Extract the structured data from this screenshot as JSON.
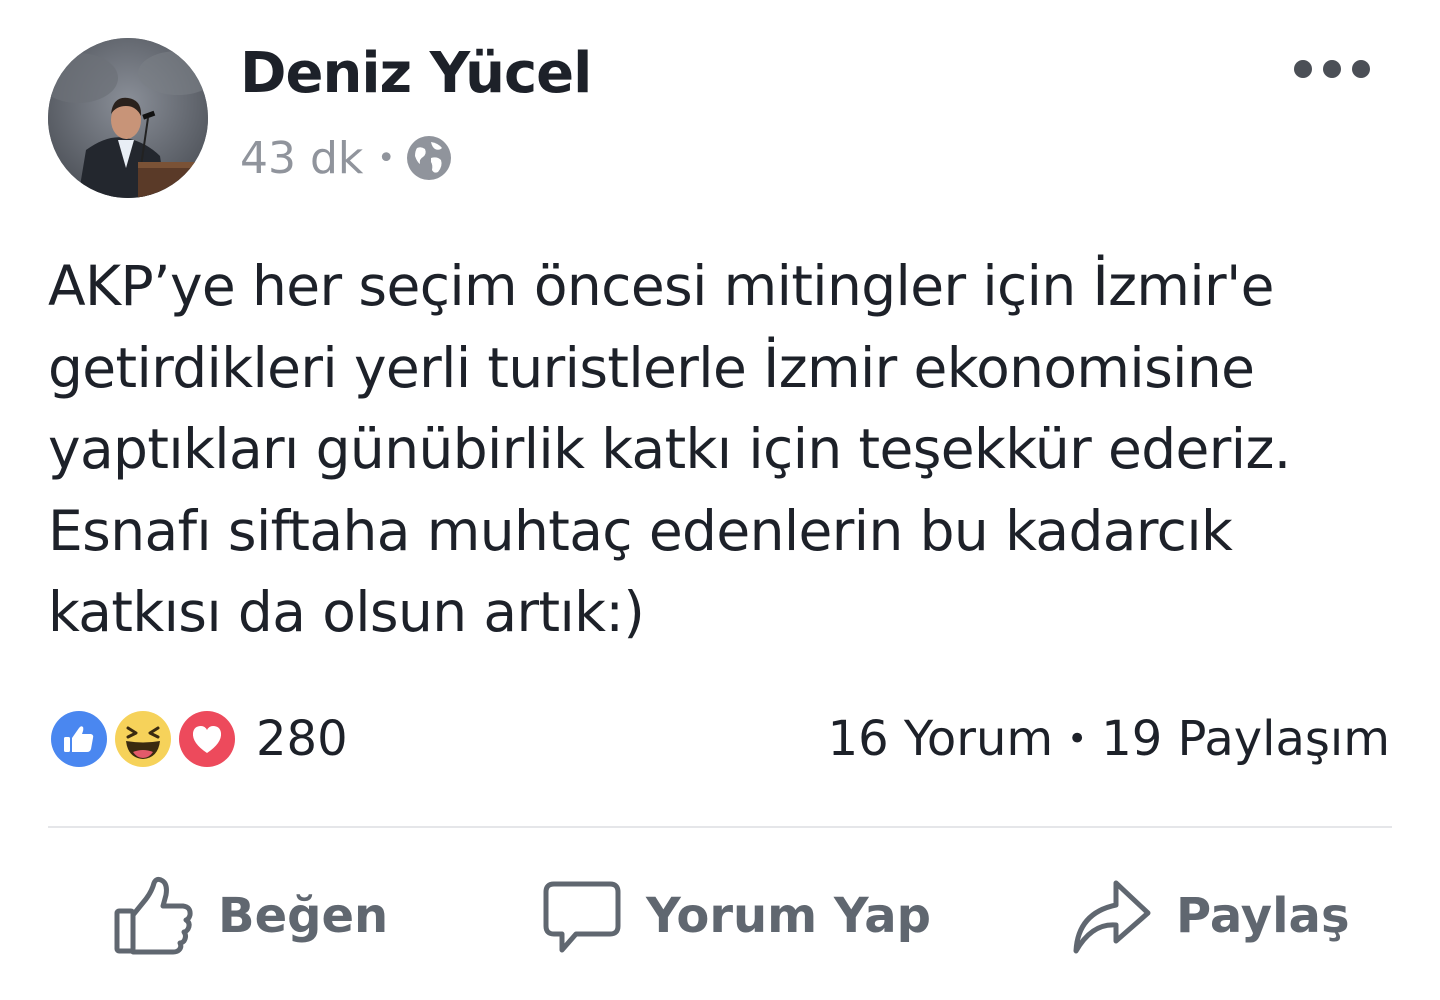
{
  "post": {
    "author_name": "Deniz Yücel",
    "timestamp": "43 dk",
    "meta_separator": "•",
    "privacy_icon": "globe-icon",
    "more_icon": "more-options-icon",
    "text_lines": [
      "AKP’ye her seçim öncesi mitingler için İzmir'e",
      "getirdikleri yerli turistlerle İzmir ekonomisine",
      "yaptıkları günübirlik katkı için teşekkür ederiz.",
      "Esnafı siftaha muhtaç edenlerin bu kadarcık",
      "katkısı da olsun artık:)"
    ]
  },
  "reactions": {
    "icons": [
      "like-reaction-icon",
      "haha-reaction-icon",
      "love-reaction-icon"
    ],
    "count": "280"
  },
  "engagement": {
    "comments": "16 Yorum",
    "separator": "•",
    "shares": "19 Paylaşım"
  },
  "actions": {
    "like_label": "Beğen",
    "comment_label": "Yorum Yap",
    "share_label": "Paylaş"
  },
  "colors": {
    "text_primary": "#1d2129",
    "text_secondary": "#90949c",
    "action_text": "#606770",
    "like_blue": "#4a87f0",
    "haha_yellow": "#f6d25a",
    "love_red": "#ed4a5c",
    "divider": "#e5e6e9"
  }
}
